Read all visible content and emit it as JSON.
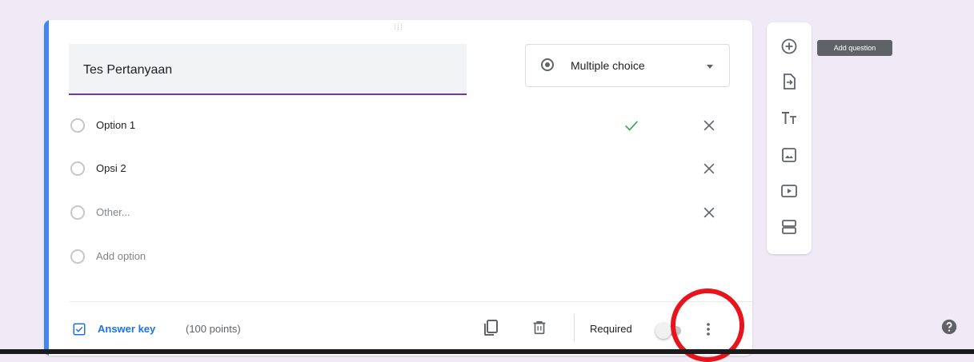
{
  "question": {
    "title": "Tes Pertanyaan",
    "drag_handle": "⁞⁞⁞",
    "type": {
      "label": "Multiple choice",
      "icon": "radio-button-icon"
    },
    "options": [
      {
        "label": "Option 1",
        "is_correct": true,
        "removable": true
      },
      {
        "label": "Opsi 2",
        "is_correct": false,
        "removable": true
      },
      {
        "label": "Other...",
        "is_correct": false,
        "removable": true
      }
    ],
    "add_option": "Add option"
  },
  "footer": {
    "answer_key_label": "Answer key",
    "points": "(100 points)",
    "required_label": "Required",
    "required_on": false
  },
  "toolbar": {
    "buttons": [
      "add-question-icon",
      "import-questions-icon",
      "add-title-icon",
      "add-image-icon",
      "add-video-icon",
      "add-section-icon"
    ],
    "tooltip": "Add question"
  },
  "colors": {
    "accent": "#4285f4",
    "title_underline": "#673ab7",
    "answer_key": "#1a73e8",
    "check": "#34a853",
    "highlight_circle": "#e8141c",
    "background": "#efeaf6"
  }
}
